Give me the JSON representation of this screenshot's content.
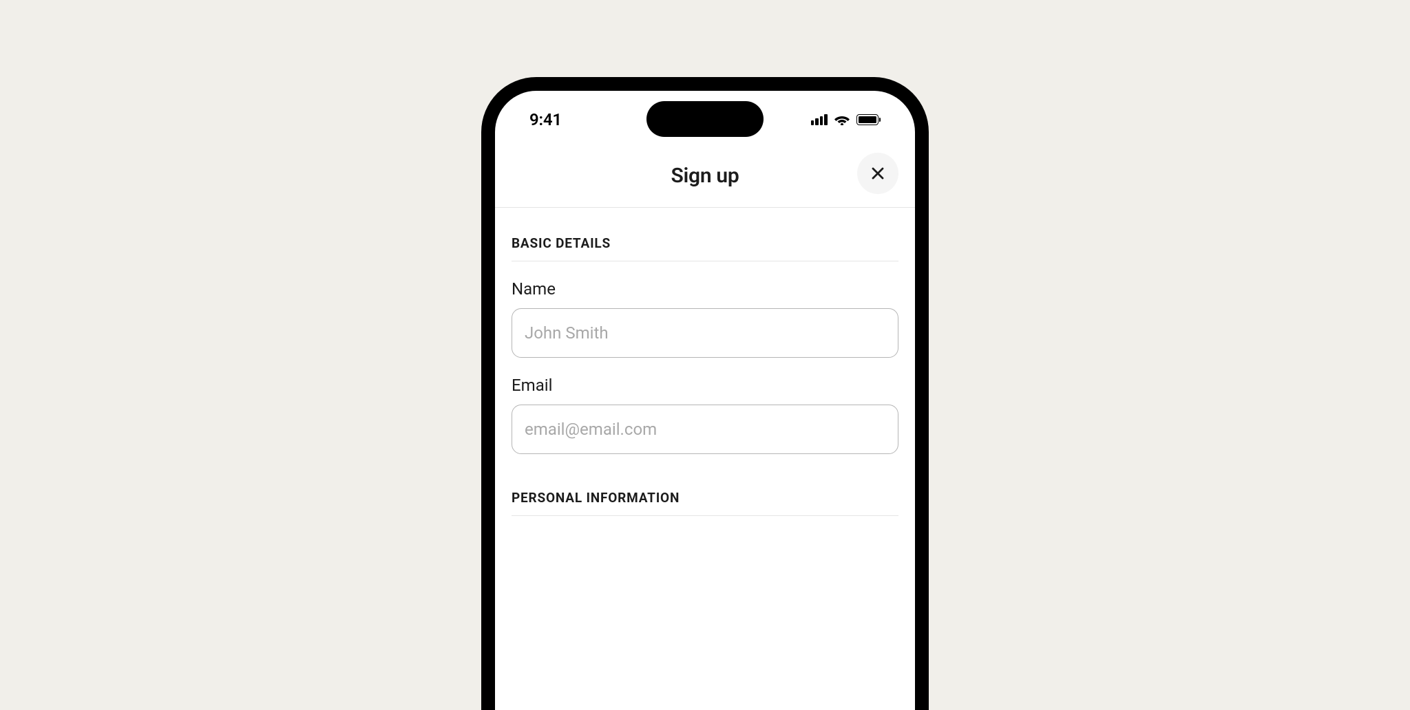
{
  "statusBar": {
    "time": "9:41"
  },
  "header": {
    "title": "Sign up"
  },
  "sections": {
    "basicDetails": {
      "heading": "BASIC DETAILS",
      "fields": {
        "name": {
          "label": "Name",
          "placeholder": "John Smith",
          "value": ""
        },
        "email": {
          "label": "Email",
          "placeholder": "email@email.com",
          "value": ""
        }
      }
    },
    "personalInformation": {
      "heading": "PERSONAL INFORMATION"
    }
  }
}
